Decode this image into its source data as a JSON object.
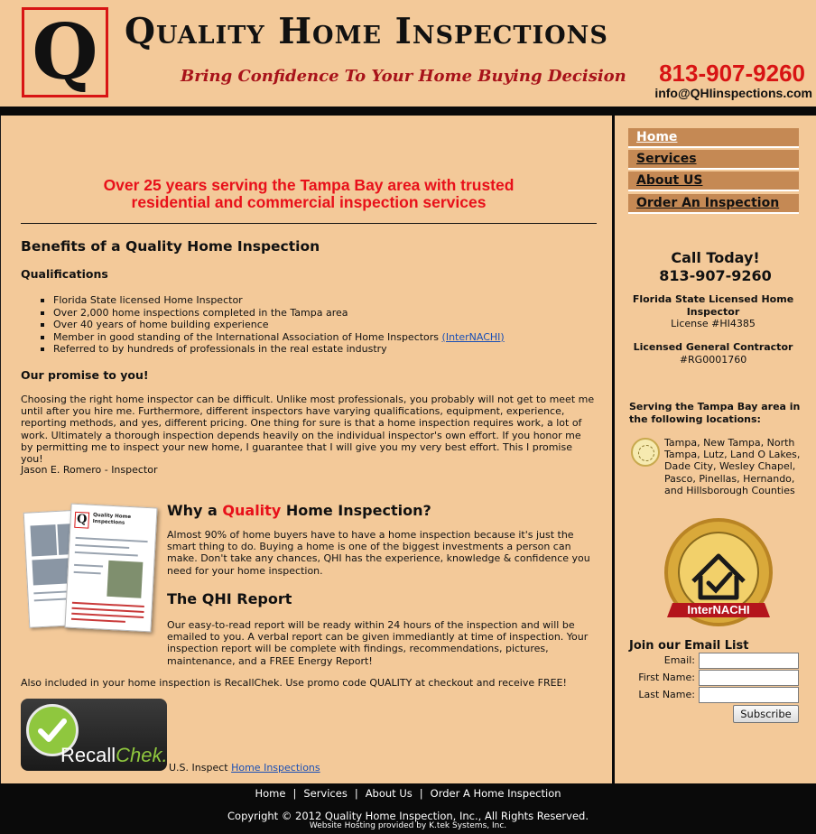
{
  "header": {
    "logo_letter": "Q",
    "title": "Quality Home Inspections",
    "tagline": "Bring Confidence To Your Home Buying Decision",
    "phone": "813-907-9260",
    "email": "info@QHIinspections.com"
  },
  "nav": {
    "items": [
      {
        "label": "Home",
        "active": true
      },
      {
        "label": "Services",
        "active": false
      },
      {
        "label": "About US",
        "active": false
      },
      {
        "label": "Order An Inspection",
        "active": false
      }
    ]
  },
  "main": {
    "tagline_line1": "Over 25 years serving the Tampa Bay area with trusted",
    "tagline_line2": "residential and commercial inspection services",
    "benefits_title": "Benefits of a Quality Home Inspection",
    "qualifications_title": "Qualifications",
    "qualifications": [
      "Florida State licensed Home Inspector",
      "Over 2,000 home inspections completed in the Tampa area",
      "Over 40 years of home building experience",
      "Member in good standing of the International Association of Home Inspectors",
      "Referred to by hundreds of professionals in the real estate industry"
    ],
    "internachi_link": "(InterNACHI)",
    "promise_title": "Our promise to you!",
    "promise_text": "Choosing the right home inspector can be difficult. Unlike most professionals, you probably will not get to meet me until after you hire me. Furthermore, different inspectors have varying qualifications, equipment, experience, reporting methods, and yes, different pricing. One thing for sure is that a home inspection requires work, a lot of work. Ultimately a thorough inspection depends heavily on the individual inspector's own effort. If you honor me by permitting me to inspect your new home, I guarantee that I will give you my very best effort. This I promise you!",
    "signature": "Jason E. Romero - Inspector",
    "why_prefix": "Why a ",
    "why_highlight": "Quality",
    "why_suffix": " Home Inspection?",
    "why_text": "Almost 90% of home buyers have to have a home inspection because it's just the smart thing to do. Buying a home is one of the biggest investments a person can make. Don't take any chances, QHI has the experience, knowledge & confidence you need for your home inspection.",
    "report_title": "The QHI Report",
    "report_text": "Our easy-to-read report will be ready within 24 hours of the inspection and will be emailed to you. A verbal report can be given immediantly at time of inspection. Your inspection report will be complete with findings, recommendations, pictures, maintenance, and a FREE Energy Report!",
    "recall_line": "Also included in your home inspection is RecallChek. Use promo code QUALITY at checkout and receive FREE!",
    "report_image": {
      "logo_letter": "Q",
      "logo_title": "Quality Home Inspections"
    },
    "recall_badge": {
      "part1": "Recall",
      "part2": "Chek",
      "mark": "."
    },
    "us_inspect_text": "U.S. Inspect",
    "home_inspections_link": "Home Inspections"
  },
  "sidebar": {
    "call_title": "Call Today!",
    "call_phone": "813-907-9260",
    "license1_title": "Florida State Licensed Home Inspector",
    "license1_number": "License #HI4385",
    "license2_title": "Licensed General Contractor",
    "license2_number": "#RG0001760",
    "serving_title": "Serving the Tampa Bay area in the following locations:",
    "locations": "Tampa, New Tampa, North Tampa, Lutz, Land O Lakes, Dade City, Wesley Chapel, Pasco, Pinellas, Hernando, and Hillsborough Counties",
    "badge_text": "InterNACHI",
    "join_title": "Join our Email List",
    "email_label": "Email:",
    "first_name_label": "First Name:",
    "last_name_label": "Last Name:",
    "email_value": "",
    "first_name_value": "",
    "last_name_value": "",
    "subscribe_label": "Subscribe"
  },
  "footer": {
    "nav": [
      "Home",
      "Services",
      "About Us",
      "Order A Home Inspection"
    ],
    "separator": "|",
    "copyright": "Copyright © 2012 Quality Home Inspection, Inc., All Rights Reserved.",
    "hosting": "Website Hosting  provided by  K.tek Systems, Inc."
  },
  "colors": {
    "background": "#f3c999",
    "accent_red": "#e8101a",
    "nav_bg": "#c58954",
    "bar": "#0a0a0a",
    "link": "#1a4fb5"
  }
}
